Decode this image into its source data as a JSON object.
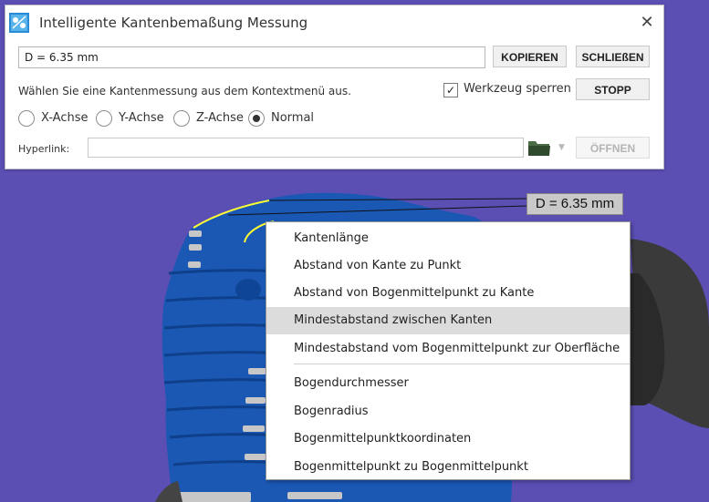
{
  "dialog": {
    "title": "Intelligente Kantenbemaßung Messung",
    "measurement_value": "D = 6.35 mm",
    "copy_label": "KOPIEREN",
    "close_label": "SCHLIEßEN",
    "hint_text": "Wählen Sie eine Kantenmessung aus dem Kontextmenü aus.",
    "lock_tool_label": "Werkzeug sperren",
    "lock_tool_checked": true,
    "stop_label": "STOPP",
    "radio_options": [
      {
        "label": "X-Achse",
        "checked": false
      },
      {
        "label": "Y-Achse",
        "checked": false
      },
      {
        "label": "Z-Achse",
        "checked": false
      },
      {
        "label": "Normal",
        "checked": true
      }
    ],
    "hyperlink_label": "Hyperlink:",
    "hyperlink_value": "",
    "open_label": "ÖFFNEN",
    "open_disabled": true
  },
  "viewport": {
    "background_color": "#5b4fb4",
    "part_color": "#1a58b4",
    "callout_text": "D = 6.35 mm"
  },
  "context_menu": {
    "items_top": [
      "Kantenlänge",
      "Abstand von Kante zu Punkt",
      "Abstand von Bogenmittelpunkt zu Kante",
      "Mindestabstand zwischen Kanten",
      "Mindestabstand vom Bogenmittelpunkt zur Oberfläche"
    ],
    "items_bottom": [
      "Bogendurchmesser",
      "Bogenradius",
      "Bogenmittelpunktkoordinaten",
      "Bogenmittelpunkt zu Bogenmittelpunkt"
    ],
    "highlighted": "Mindestabstand zwischen Kanten"
  }
}
